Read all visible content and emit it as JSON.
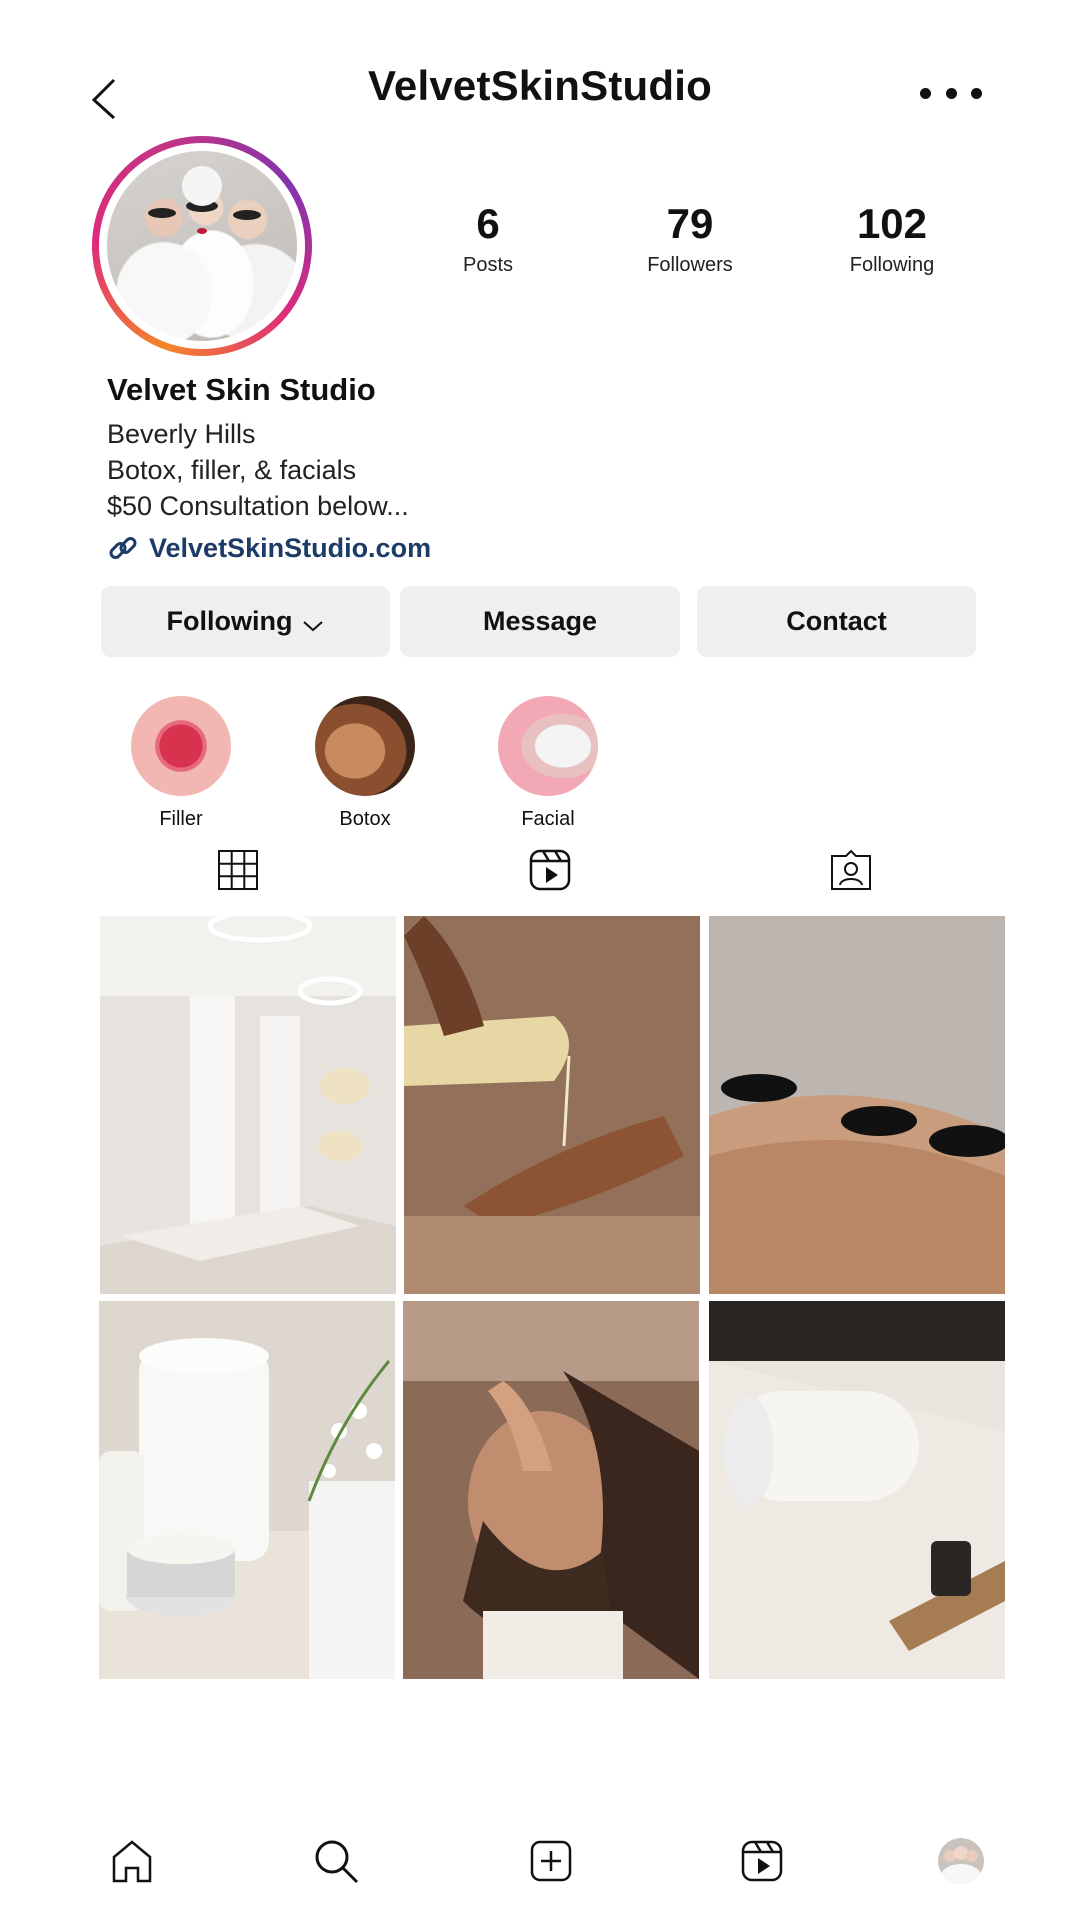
{
  "header": {
    "title": "VelvetSkinStudio",
    "back_icon": "back-arrow-icon",
    "more_icon": "more-dots-icon"
  },
  "stats": [
    {
      "value": "6",
      "label": "Posts"
    },
    {
      "value": "79",
      "label": "Followers"
    },
    {
      "value": "102",
      "label": "Following"
    }
  ],
  "profile": {
    "name": "Velvet Skin Studio",
    "bio": [
      "Beverly Hills",
      "Botox, filler, & facials",
      "$50 Consultation below..."
    ],
    "link": "VelvetSkinStudio.com",
    "link_color": "#1d3b67"
  },
  "buttons": {
    "following": "Following",
    "message": "Message",
    "contact": "Contact"
  },
  "highlights": [
    {
      "label": "Filler"
    },
    {
      "label": "Botox"
    },
    {
      "label": "Facial"
    }
  ],
  "tabs": [
    "grid-icon",
    "reels-icon",
    "tagged-icon"
  ],
  "grid_posts": [
    "spa-room-photo",
    "oil-massage-photo",
    "hot-stones-photo",
    "candle-towel-photo",
    "face-massage-photo",
    "rolled-towel-photo"
  ],
  "bottom_nav": [
    "home-icon",
    "search-icon",
    "create-icon",
    "reels-icon",
    "profile-avatar"
  ]
}
